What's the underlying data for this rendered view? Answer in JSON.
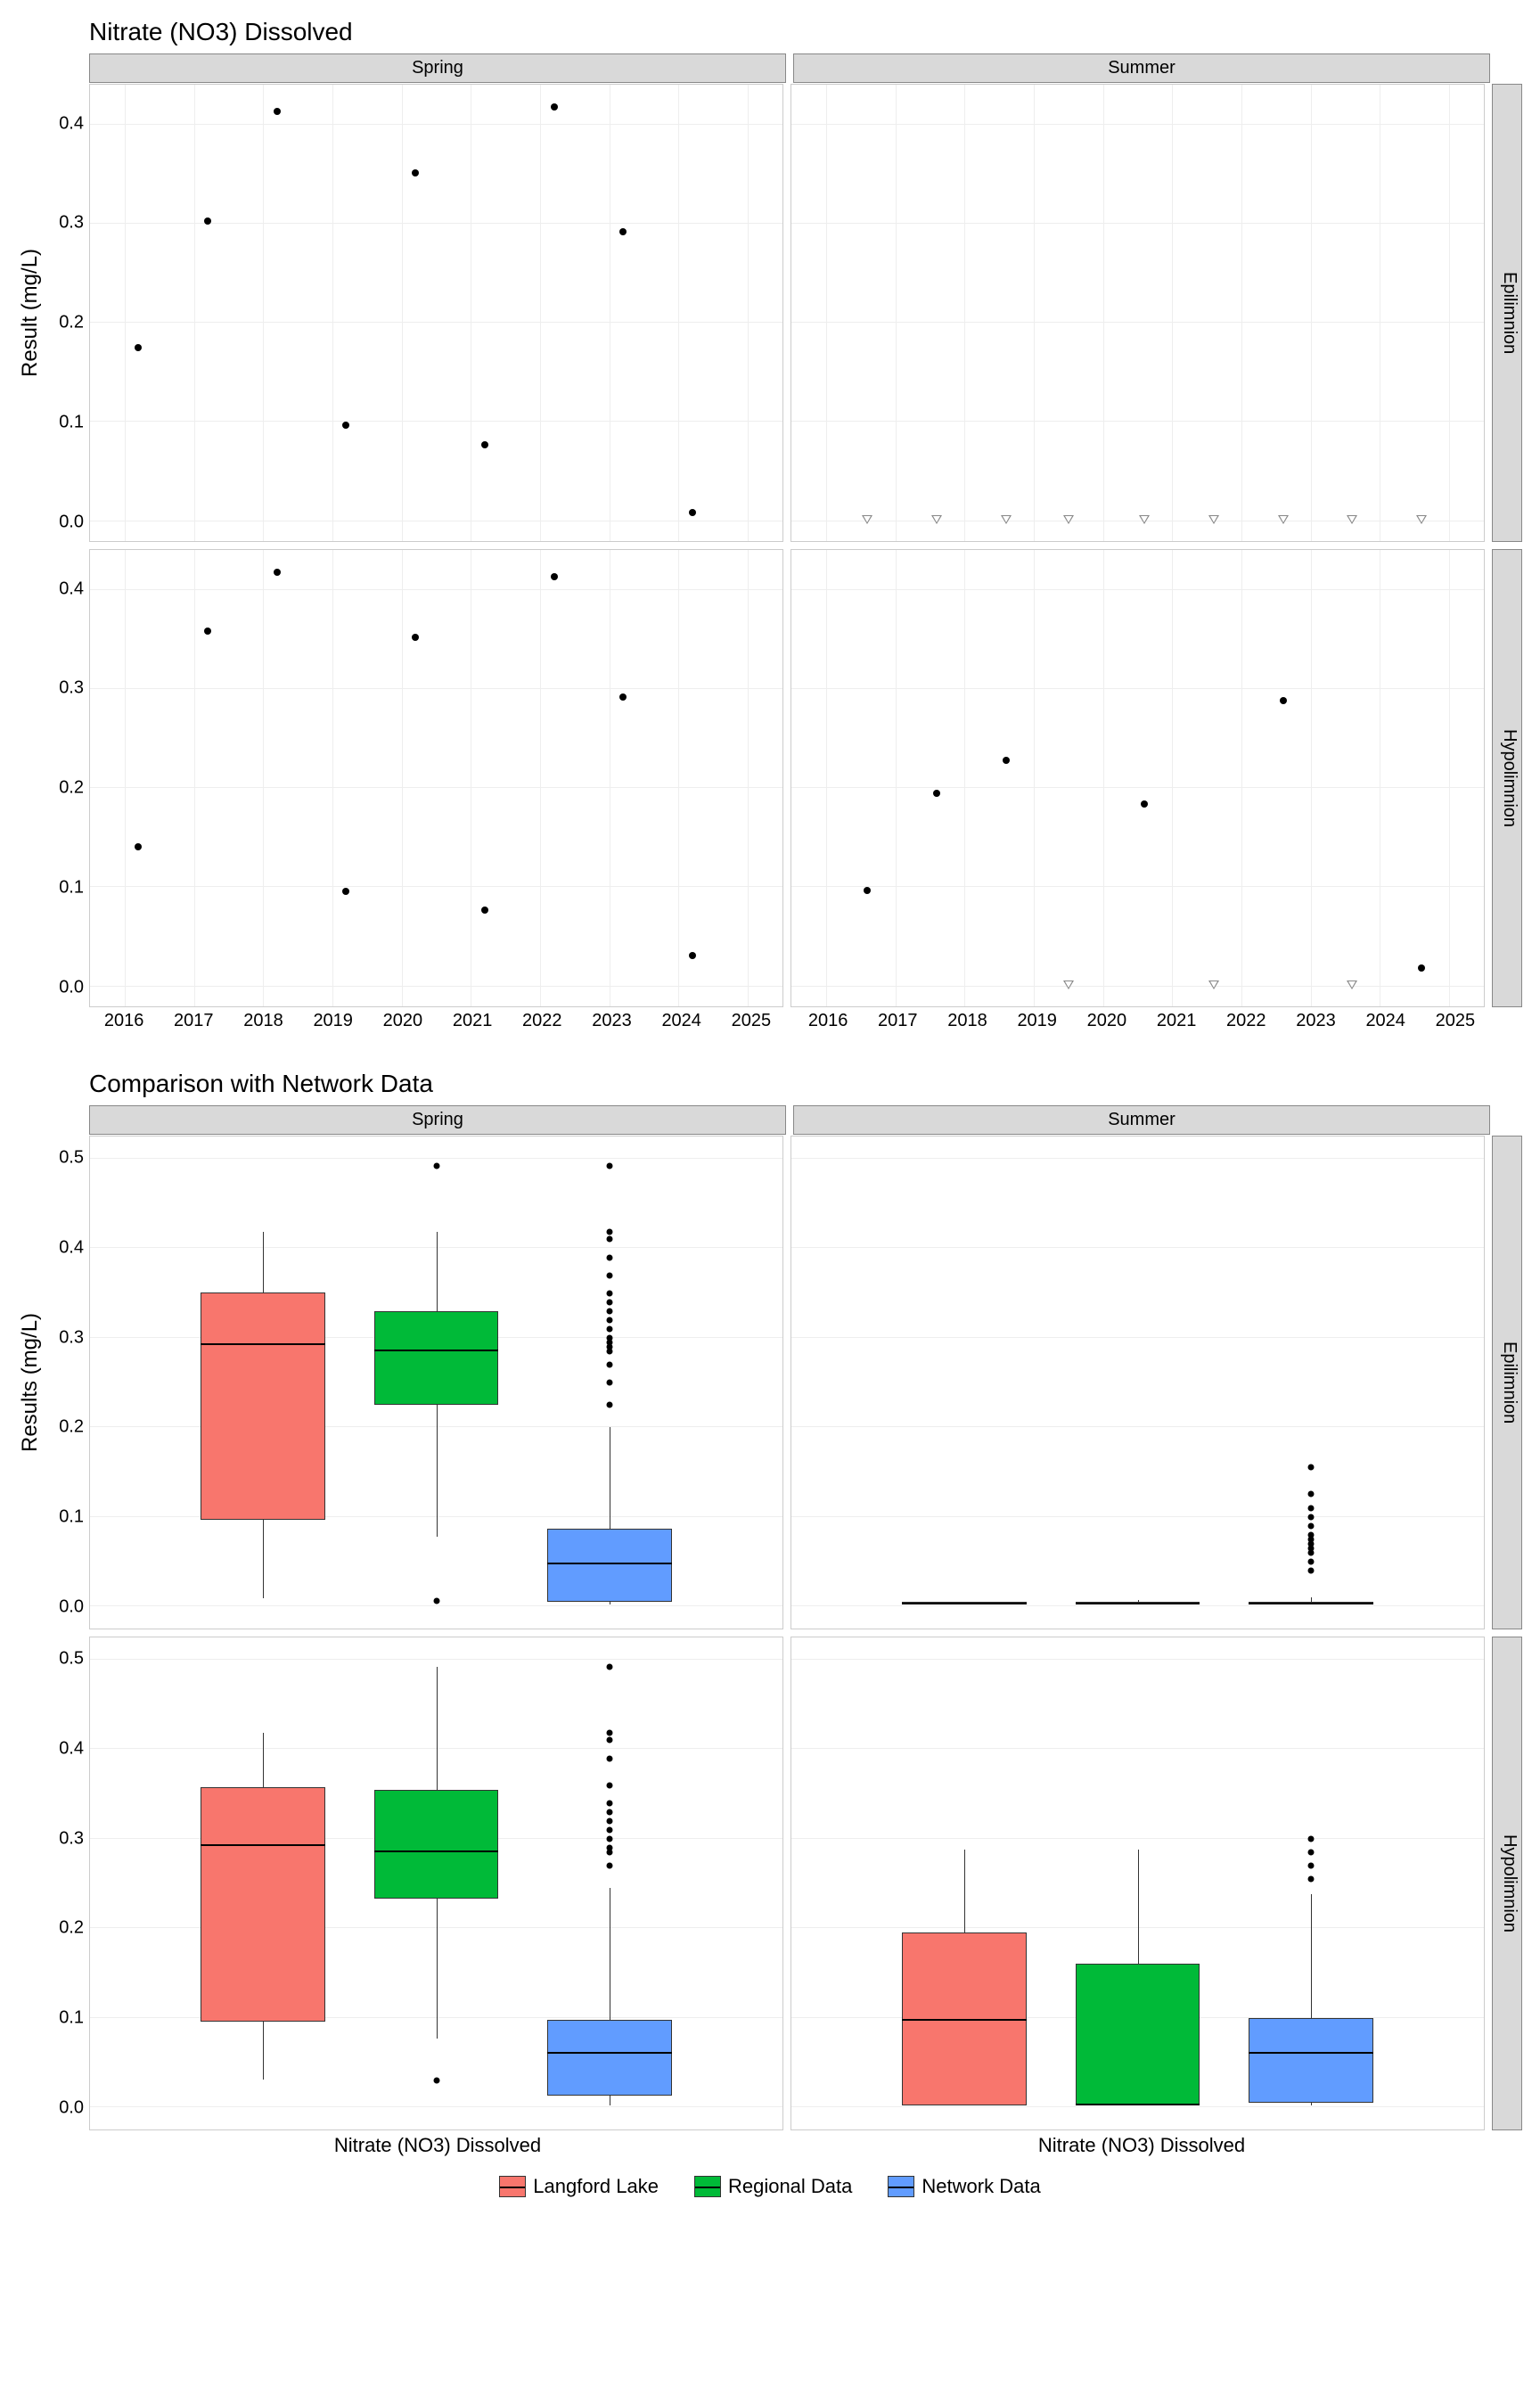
{
  "chart_data": [
    {
      "type": "scatter",
      "title": "Nitrate (NO3) Dissolved",
      "ylabel": "Result (mg/L)",
      "facet_cols": [
        "Spring",
        "Summer"
      ],
      "facet_rows": [
        "Epilimnion",
        "Hypolimnion"
      ],
      "xlim": [
        2015.5,
        2025.5
      ],
      "ylim": [
        -0.02,
        0.44
      ],
      "xticks": [
        2016,
        2017,
        2018,
        2019,
        2020,
        2021,
        2022,
        2023,
        2024,
        2025
      ],
      "yticks": [
        0.0,
        0.1,
        0.2,
        0.3,
        0.4
      ],
      "series": [
        {
          "facet_row": "Epilimnion",
          "facet_col": "Spring",
          "marker": "dot",
          "points": [
            {
              "x": 2016.2,
              "y": 0.175
            },
            {
              "x": 2017.2,
              "y": 0.303
            },
            {
              "x": 2018.2,
              "y": 0.413
            },
            {
              "x": 2019.2,
              "y": 0.097
            },
            {
              "x": 2020.2,
              "y": 0.351
            },
            {
              "x": 2021.2,
              "y": 0.077
            },
            {
              "x": 2022.2,
              "y": 0.418
            },
            {
              "x": 2023.2,
              "y": 0.292
            },
            {
              "x": 2024.2,
              "y": 0.009
            }
          ]
        },
        {
          "facet_row": "Epilimnion",
          "facet_col": "Summer",
          "marker": "triangle",
          "points": [
            {
              "x": 2016.6,
              "y": 0.002
            },
            {
              "x": 2017.6,
              "y": 0.002
            },
            {
              "x": 2018.6,
              "y": 0.002
            },
            {
              "x": 2019.5,
              "y": 0.002
            },
            {
              "x": 2020.6,
              "y": 0.002
            },
            {
              "x": 2021.6,
              "y": 0.002
            },
            {
              "x": 2022.6,
              "y": 0.002
            },
            {
              "x": 2023.6,
              "y": 0.002
            },
            {
              "x": 2024.6,
              "y": 0.002
            }
          ]
        },
        {
          "facet_row": "Hypolimnion",
          "facet_col": "Spring",
          "marker": "dot",
          "points": [
            {
              "x": 2016.2,
              "y": 0.141
            },
            {
              "x": 2017.2,
              "y": 0.358
            },
            {
              "x": 2018.2,
              "y": 0.418
            },
            {
              "x": 2019.2,
              "y": 0.096
            },
            {
              "x": 2020.2,
              "y": 0.352
            },
            {
              "x": 2021.2,
              "y": 0.077
            },
            {
              "x": 2022.2,
              "y": 0.413
            },
            {
              "x": 2023.2,
              "y": 0.292
            },
            {
              "x": 2024.2,
              "y": 0.031
            }
          ]
        },
        {
          "facet_row": "Hypolimnion",
          "facet_col": "Summer",
          "marker": "mixed",
          "points": [
            {
              "x": 2016.6,
              "y": 0.097,
              "m": "dot"
            },
            {
              "x": 2017.6,
              "y": 0.195,
              "m": "dot"
            },
            {
              "x": 2018.6,
              "y": 0.228,
              "m": "dot"
            },
            {
              "x": 2019.5,
              "y": 0.002,
              "m": "triangle"
            },
            {
              "x": 2020.6,
              "y": 0.184,
              "m": "dot"
            },
            {
              "x": 2021.6,
              "y": 0.002,
              "m": "triangle"
            },
            {
              "x": 2022.6,
              "y": 0.288,
              "m": "dot"
            },
            {
              "x": 2023.6,
              "y": 0.002,
              "m": "triangle"
            },
            {
              "x": 2024.6,
              "y": 0.019,
              "m": "dot"
            }
          ]
        }
      ]
    },
    {
      "type": "boxplot",
      "title": "Comparison with Network Data",
      "ylabel": "Results (mg/L)",
      "xlabel": "Nitrate (NO3) Dissolved",
      "facet_cols": [
        "Spring",
        "Summer"
      ],
      "facet_rows": [
        "Epilimnion",
        "Hypolimnion"
      ],
      "ylim": [
        -0.025,
        0.525
      ],
      "yticks": [
        0.0,
        0.1,
        0.2,
        0.3,
        0.4,
        0.5
      ],
      "legend": [
        {
          "name": "Langford Lake",
          "color": "#f8766d"
        },
        {
          "name": "Regional Data",
          "color": "#00ba38"
        },
        {
          "name": "Network Data",
          "color": "#619cff"
        }
      ],
      "boxes": {
        "Spring|Epilimnion": [
          {
            "group": "Langford Lake",
            "color": "#f8766d",
            "min": 0.009,
            "q1": 0.097,
            "median": 0.292,
            "q3": 0.351,
            "max": 0.418,
            "outliers": []
          },
          {
            "group": "Regional Data",
            "color": "#00ba38",
            "min": 0.078,
            "q1": 0.225,
            "median": 0.285,
            "q3": 0.33,
            "max": 0.418,
            "outliers": [
              0.006,
              0.492
            ]
          },
          {
            "group": "Network Data",
            "color": "#619cff",
            "min": 0.002,
            "q1": 0.005,
            "median": 0.047,
            "q3": 0.087,
            "max": 0.2,
            "outliers": [
              0.225,
              0.25,
              0.27,
              0.285,
              0.29,
              0.295,
              0.3,
              0.31,
              0.32,
              0.33,
              0.34,
              0.35,
              0.37,
              0.39,
              0.41,
              0.418,
              0.492
            ]
          }
        ],
        "Spring|Hypolimnion": [
          {
            "group": "Langford Lake",
            "color": "#f8766d",
            "min": 0.031,
            "q1": 0.096,
            "median": 0.292,
            "q3": 0.358,
            "max": 0.418,
            "outliers": []
          },
          {
            "group": "Regional Data",
            "color": "#00ba38",
            "min": 0.077,
            "q1": 0.233,
            "median": 0.285,
            "q3": 0.355,
            "max": 0.492,
            "outliers": [
              0.03
            ]
          },
          {
            "group": "Network Data",
            "color": "#619cff",
            "min": 0.002,
            "q1": 0.013,
            "median": 0.06,
            "q3": 0.098,
            "max": 0.245,
            "outliers": [
              0.27,
              0.285,
              0.29,
              0.3,
              0.31,
              0.32,
              0.33,
              0.34,
              0.36,
              0.39,
              0.41,
              0.418,
              0.492
            ]
          }
        ],
        "Summer|Epilimnion": [
          {
            "group": "Langford Lake",
            "color": "#f8766d",
            "min": 0.002,
            "q1": 0.002,
            "median": 0.002,
            "q3": 0.002,
            "max": 0.002,
            "outliers": []
          },
          {
            "group": "Regional Data",
            "color": "#00ba38",
            "min": 0.002,
            "q1": 0.002,
            "median": 0.002,
            "q3": 0.002,
            "max": 0.007,
            "outliers": []
          },
          {
            "group": "Network Data",
            "color": "#619cff",
            "min": 0.002,
            "q1": 0.002,
            "median": 0.002,
            "q3": 0.005,
            "max": 0.01,
            "outliers": [
              0.04,
              0.05,
              0.06,
              0.065,
              0.07,
              0.075,
              0.08,
              0.09,
              0.1,
              0.11,
              0.125,
              0.155
            ]
          }
        ],
        "Summer|Hypolimnion": [
          {
            "group": "Langford Lake",
            "color": "#f8766d",
            "min": 0.002,
            "q1": 0.002,
            "median": 0.097,
            "q3": 0.195,
            "max": 0.288,
            "outliers": []
          },
          {
            "group": "Regional Data",
            "color": "#00ba38",
            "min": 0.002,
            "q1": 0.002,
            "median": 0.002,
            "q3": 0.16,
            "max": 0.288,
            "outliers": []
          },
          {
            "group": "Network Data",
            "color": "#619cff",
            "min": 0.002,
            "q1": 0.005,
            "median": 0.06,
            "q3": 0.1,
            "max": 0.238,
            "outliers": [
              0.255,
              0.27,
              0.285,
              0.3
            ]
          }
        ]
      }
    }
  ],
  "titles": {
    "t1": "Nitrate (NO3) Dissolved",
    "t2": "Comparison with Network Data"
  },
  "labels": {
    "yl1": "Result (mg/L)",
    "yl2": "Results (mg/L)",
    "xl2": "Nitrate (NO3) Dissolved",
    "spring": "Spring",
    "summer": "Summer",
    "epi": "Epilimnion",
    "hypo": "Hypolimnion"
  },
  "legend": {
    "a": "Langford Lake",
    "b": "Regional Data",
    "c": "Network Data"
  }
}
